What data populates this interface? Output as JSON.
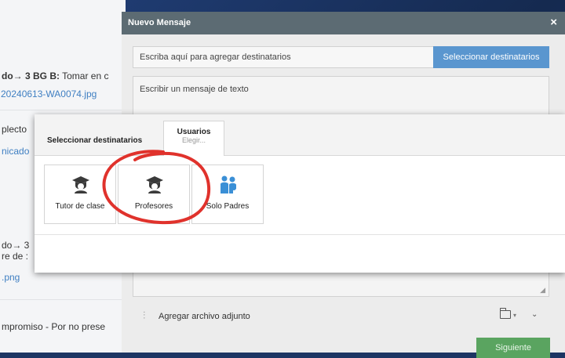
{
  "background_page": {
    "row1_bold": "do→ 3 BG B:",
    "row1_rest": " Tomar en c",
    "row1_link": "20240613-WA0074.jpg",
    "row2_text": "plecto",
    "row2_link": "nicado",
    "row3_text": "do→ 3",
    "row3_text2": "re de :",
    "row3_link": ".png",
    "row4_text": "mpromiso - Por no prese"
  },
  "modal": {
    "title": "Nuevo Mensaje",
    "close_label": "×",
    "recipients_placeholder": "Escriba aquí para agregar destinatarios",
    "select_recipients_button": "Seleccionar destinatarios",
    "message_placeholder": "Escribir un mensaje de texto",
    "attach_label": "Agregar archivo adjunto",
    "next_button": "Siguiente"
  },
  "selector": {
    "title": "Seleccionar destinatarios",
    "tab_title": "Usuarios",
    "tab_subtitle": "Elegir...",
    "options": [
      {
        "label": "Tutor de clase",
        "icon": "teacher-icon"
      },
      {
        "label": "Profesores",
        "icon": "teacher-icon"
      },
      {
        "label": "Solo Padres",
        "icon": "parents-icon"
      }
    ]
  },
  "annotation": {
    "color": "#e0322c",
    "target": "Profesores"
  },
  "colors": {
    "header": "#5c6b73",
    "primary_button": "#5a96cf",
    "next_button": "#5aa460",
    "parents_icon": "#3a8fd6"
  }
}
